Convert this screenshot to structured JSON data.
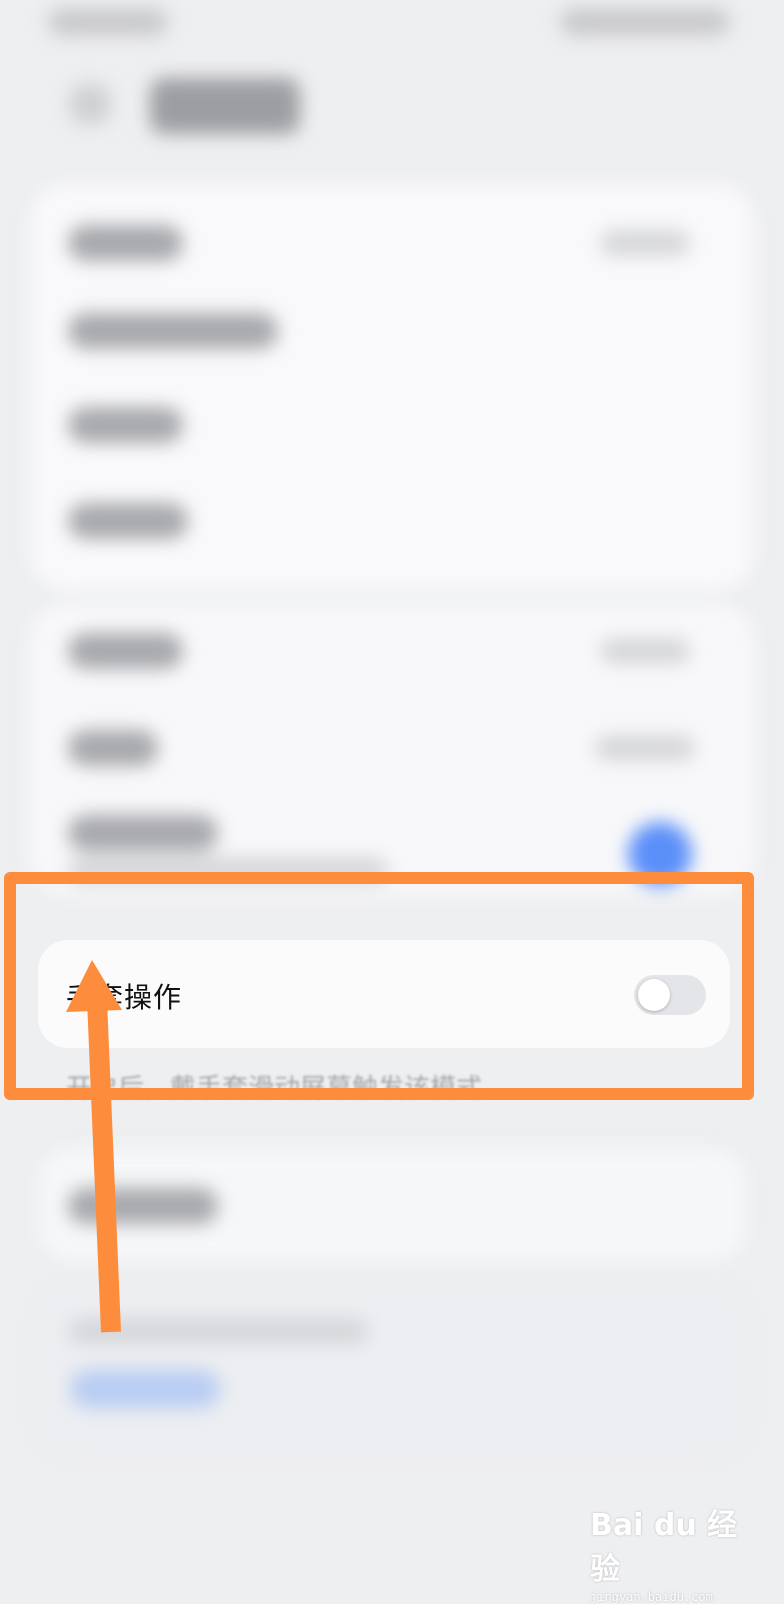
{
  "setting": {
    "label": "手套操作",
    "enabled": false,
    "description": "开启后，戴手套滑动屏幕触发该模式"
  },
  "colors": {
    "annotation": "#fd8d3c",
    "toggle_off": "#e4e5e8",
    "accent_blue": "#5b8ff9"
  },
  "watermark": {
    "logo": "Bai du 经验",
    "url": "jingyan.baidu.com"
  }
}
